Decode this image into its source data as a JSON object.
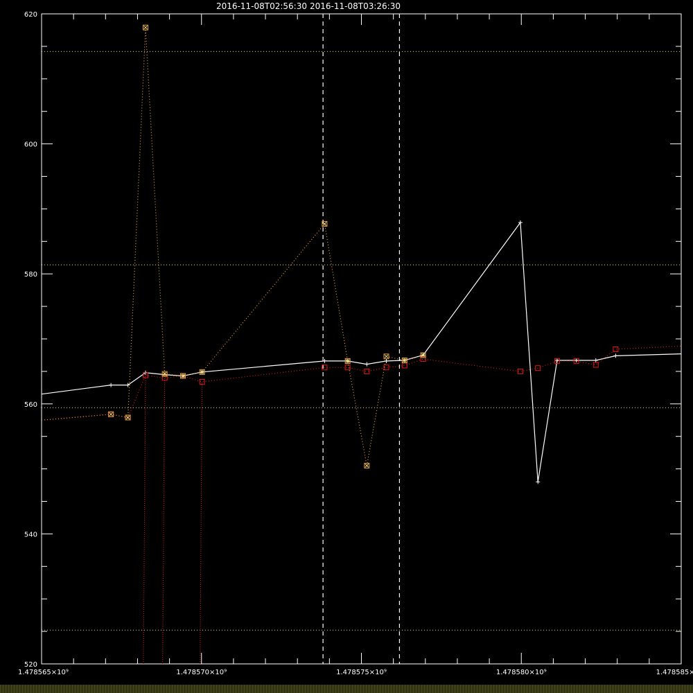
{
  "chart_data": {
    "type": "line",
    "title_left": "2016-11-08T02:56:30",
    "title_right": "2016-11-08T03:26:30",
    "xlim": [
      1478565000,
      1478585000
    ],
    "ylim": [
      520,
      620
    ],
    "x_ticks": [
      {
        "value": 1478565000,
        "label": "1.478565×10⁹"
      },
      {
        "value": 1478570000,
        "label": "1.478570×10⁹"
      },
      {
        "value": 1478575000,
        "label": "1.478575×10⁹"
      },
      {
        "value": 1478580000,
        "label": "1.478580×10⁹"
      },
      {
        "value": 1478585000,
        "label": "1.478585×10⁹"
      }
    ],
    "y_ticks": [
      520,
      540,
      560,
      580,
      600,
      620
    ],
    "y_minor_ticks": [
      525,
      530,
      535,
      545,
      550,
      555,
      565,
      570,
      575,
      585,
      590,
      595,
      605,
      610,
      615
    ],
    "vertical_markers": [
      1478573800,
      1478576190
    ],
    "horizontal_lines": [
      614.2,
      581.4,
      559.4,
      525.2
    ],
    "colors": {
      "white": "#ffffff",
      "red": "#e01818",
      "orange": "#e8a040",
      "yellow": "#f0e070"
    },
    "series": [
      {
        "style": "white-solid",
        "x": [
          1478565000,
          1478567170,
          1478567700,
          1478568250,
          1478568850,
          1478569420,
          1478570020,
          1478573850,
          1478574570,
          1478575170,
          1478575780,
          1478576350,
          1478576930,
          1478579970,
          1478580520,
          1478581120,
          1478581720,
          1478582330,
          1478582950,
          1478585000
        ],
        "y": [
          561.5,
          562.9,
          562.9,
          564.8,
          564.5,
          564.3,
          564.9,
          566.6,
          566.6,
          566.1,
          566.6,
          566.7,
          567.5,
          587.9,
          548.0,
          566.7,
          566.7,
          566.7,
          567.4,
          567.7
        ],
        "markers": [
          false,
          true,
          true,
          true,
          true,
          true,
          true,
          true,
          true,
          true,
          true,
          true,
          true,
          true,
          true,
          true,
          true,
          true,
          true,
          false
        ]
      },
      {
        "style": "red-dotted",
        "x": [
          1478565000,
          1478567170,
          1478567700,
          1478568250,
          1478568850,
          1478569420,
          1478570020,
          1478573850,
          1478574570,
          1478575170,
          1478575780,
          1478576350,
          1478576930,
          1478579970,
          1478580520,
          1478581120,
          1478581720,
          1478582330,
          1478582950,
          1478585000
        ],
        "y": [
          557.5,
          558.4,
          557.9,
          564.4,
          564.0,
          564.3,
          563.4,
          565.6,
          565.6,
          565.0,
          565.6,
          565.9,
          566.9,
          565.0,
          565.5,
          566.6,
          566.6,
          566.0,
          568.4,
          568.9
        ],
        "markers": [
          false,
          true,
          true,
          true,
          true,
          true,
          true,
          true,
          true,
          true,
          true,
          true,
          true,
          true,
          true,
          true,
          true,
          true,
          true,
          false
        ]
      },
      {
        "style": "orange-dotted",
        "x": [
          1478565000,
          1478567170,
          1478567700,
          1478568250,
          1478568850,
          1478569420,
          1478570020,
          1478573850,
          1478574570,
          1478575170,
          1478575780,
          1478576350,
          1478576930
        ],
        "y": [
          557.5,
          558.4,
          557.9,
          617.9,
          564.6,
          564.3,
          564.9,
          587.7,
          566.6,
          550.5,
          567.3,
          566.7,
          567.5
        ],
        "markers": [
          false,
          true,
          true,
          true,
          true,
          true,
          true,
          true,
          true,
          true,
          true,
          true,
          true
        ]
      }
    ],
    "drop_lines": [
      {
        "x_top": 1478568250,
        "y_top": 564.4
      },
      {
        "x_top": 1478568850,
        "y_top": 564.0
      },
      {
        "x_top": 1478570020,
        "y_top": 563.4
      }
    ]
  }
}
